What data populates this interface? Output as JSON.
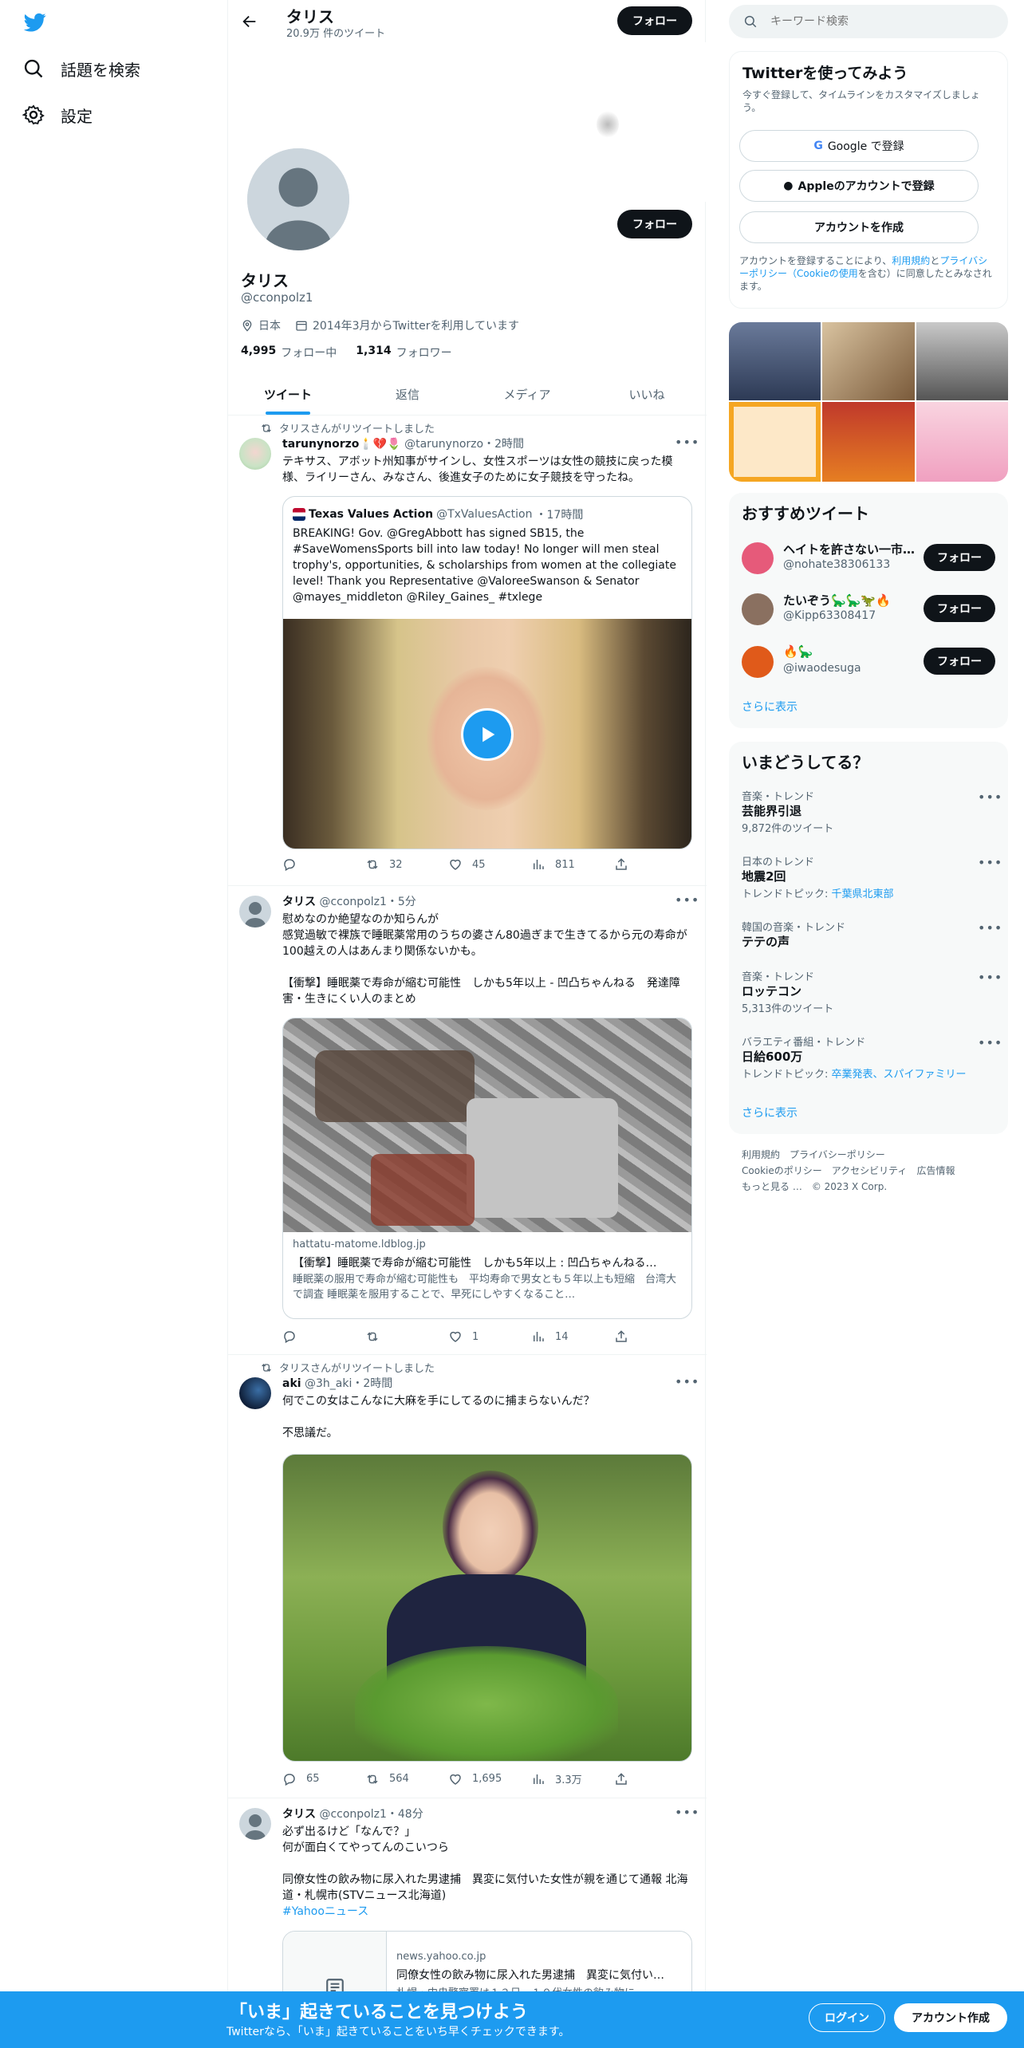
{
  "nav": {
    "explore": "話題を検索",
    "settings": "設定"
  },
  "header": {
    "name": "タリス",
    "count": "20.9万 件のツイート",
    "follow": "フォロー"
  },
  "profile": {
    "name": "タリス",
    "handle": "@cconpolz1",
    "location": "日本",
    "joined": "2014年3月からTwitterを利用しています",
    "following_count": "4,995",
    "following_label": "フォロー中",
    "followers_count": "1,314",
    "followers_label": "フォロワー",
    "follow": "フォロー"
  },
  "tabs": [
    "ツイート",
    "返信",
    "メディア",
    "いいね"
  ],
  "tweets": [
    {
      "retweet_note": "タリスさんがリツイートしました",
      "name": "tarunynorzo",
      "name_emoji": "🕯️💔🌷",
      "handle": "@tarunynorzo",
      "time": "・2時間",
      "text": "テキサス、アボット州知事がサインし、女性スポーツは女性の競技に戻った模様、ライリーさん、みなさん、後進女子のために女子競技を守ったね。",
      "quote": {
        "name": "Texas Values Action",
        "handle": "@TxValuesAction",
        "time": "・17時間",
        "text": "BREAKING! Gov. @GregAbbott has signed SB15, the #SaveWomensSports bill into law today! No longer will men steal trophy's, opportunities, & scholarships from women at the collegiate level! Thank you Representative @ValoreeSwanson & Senator @mayes_middleton @Riley_Gaines_ #txlege"
      },
      "retweets": "32",
      "likes": "45",
      "views": "811"
    },
    {
      "name": "タリス",
      "handle": "@cconpolz1",
      "time": "・5分",
      "text1": "慰めなのか絶望なのか知らんが",
      "text2": "感覚過敏で裸族で睡眠薬常用のうちの婆さん80過ぎまで生きてるから元の寿命が100越えの人はあんまり関係ないかも。",
      "text3": "【衝撃】睡眠薬で寿命が縮む可能性　しかも5年以上 - 凹凸ちゃんねる　発達障害・生きにくい人のまとめ",
      "card": {
        "domain": "hattatu-matome.ldblog.jp",
        "title": "【衝撃】睡眠薬で寿命が縮む可能性　しかも5年以上 : 凹凸ちゃんねる…",
        "desc": "睡眠薬の服用で寿命が縮む可能性も　平均寿命で男女とも５年以上も短縮　台湾大で調査 睡眠薬を服用することで、早死にしやすくなること…"
      },
      "likes": "1",
      "views": "14"
    },
    {
      "retweet_note": "タリスさんがリツイートしました",
      "name": "aki",
      "handle": "@3h_aki",
      "time": "・2時間",
      "text1": "何でこの女はこんなに大麻を手にしてるのに捕まらないんだ？",
      "text2": "不思議だ。",
      "replies": "65",
      "retweets": "564",
      "likes": "1,695",
      "views": "3.3万"
    },
    {
      "name": "タリス",
      "handle": "@cconpolz1",
      "time": "・48分",
      "text1": "必ず出るけど「なんで？」",
      "text2": "何が面白くてやってんのこいつら",
      "text3": "同僚女性の飲み物に尿入れた男逮捕　異変に気付いた女性が親を通じて通報 北海道・札幌市(STVニュース北海道)",
      "hashtag": "#Yahooニュース",
      "card": {
        "domain": "news.yahoo.co.jp",
        "title": "同僚女性の飲み物に尿入れた男逮捕　異変に気付い…",
        "desc": "札幌・中央警察署は１２日、１０代女性の飲み物に…"
      }
    }
  ],
  "search": {
    "placeholder": "キーワード検索"
  },
  "signup": {
    "title": "Twitterを使ってみよう",
    "subtitle": "今すぐ登録して、タイムラインをカスタマイズしましょう。",
    "google": "Google で登録",
    "apple": "Appleのアカウントで登録",
    "create": "アカウントを作成",
    "terms_a": "アカウントを登録することにより、",
    "terms_link1": "利用規約",
    "terms_b": "と",
    "terms_link2": "プライバシーポリシー",
    "terms_c": "（",
    "terms_link3": "Cookieの使用",
    "terms_d": "を含む）に同意したとみなされます。"
  },
  "who_to_follow": {
    "title": "おすすめツイート",
    "users": [
      {
        "name": "ヘイトを許さない一市…",
        "handle": "@nohate38306133"
      },
      {
        "name": "たいぞう🦕🦕🦖🔥",
        "handle": "@Kipp63308417"
      },
      {
        "name": "🔥🦕",
        "handle": "@iwaodesuga"
      }
    ],
    "follow": "フォロー",
    "more": "さらに表示"
  },
  "trends": {
    "title": "いまどうしてる？",
    "items": [
      {
        "meta": "音楽・トレンド",
        "name": "芸能界引退",
        "sub": "9,872件のツイート"
      },
      {
        "meta": "日本のトレンド",
        "name": "地震2回",
        "sub_label": "トレンドトピック: ",
        "sub_link": "千葉県北東部"
      },
      {
        "meta": "韓国の音楽・トレンド",
        "name": "テテの声"
      },
      {
        "meta": "音楽・トレンド",
        "name": "ロッテコン",
        "sub": "5,313件のツイート"
      },
      {
        "meta": "バラエティ番組・トレンド",
        "name": "日給600万",
        "sub_label": "トレンドトピック: ",
        "sub_link": "卒業発表、スパイファミリー"
      }
    ],
    "more": "さらに表示"
  },
  "footer": {
    "terms": "利用規約",
    "privacy": "プライバシーポリシー",
    "cookie": "Cookieのポリシー",
    "access": "アクセシビリティ",
    "ads": "広告情報",
    "more": "もっと見る …",
    "copy": "© 2023 X Corp."
  },
  "bottombar": {
    "title": "「いま」起きていることを見つけよう",
    "subtitle": "Twitterなら、「いま」起きていることをいち早くチェックできます。",
    "login": "ログイン",
    "signup": "アカウント作成"
  },
  "colors": {
    "accent": "#1d9bf0",
    "dark": "#0f1419",
    "muted": "#536471"
  }
}
